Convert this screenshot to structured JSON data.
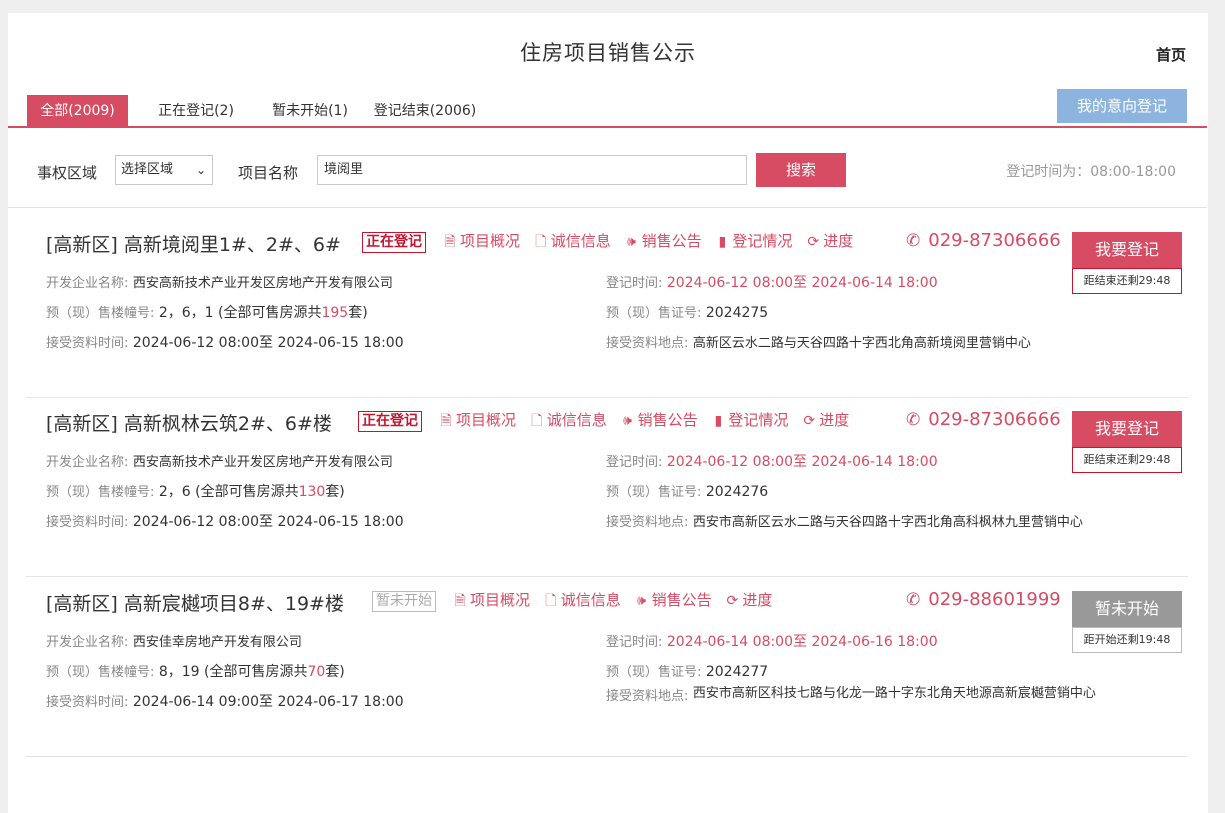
{
  "header": {
    "title": "住房项目销售公示",
    "home": "首页"
  },
  "tabs": [
    {
      "label": "全部(2009)",
      "active": true
    },
    {
      "label": "正在登记(2)",
      "active": false
    },
    {
      "label": "暂未开始(1)",
      "active": false
    },
    {
      "label": "登记结束(2006)",
      "active": false
    }
  ],
  "intent_button": "我的意向登记",
  "filter": {
    "region_label": "事权区域",
    "region_value": "选择区域",
    "name_label": "项目名称",
    "name_value": "境阅里",
    "search_button": "搜索",
    "reg_time_note": "登记时间为：08:00-18:00"
  },
  "field_labels": {
    "developer": "开发企业名称:",
    "reg_time": "登记时间:",
    "buildings": "预（现）售楼幢号:",
    "permit": "预（现）售证号:",
    "doc_time": "接受资料时间:",
    "doc_place": "接受资料地点:"
  },
  "link_labels": {
    "overview": "项目概况",
    "credit": "诚信信息",
    "notice": "销售公告",
    "reg_status": "登记情况",
    "progress": "进度"
  },
  "projects": [
    {
      "title": "[高新区] 高新境阅里1#、2#、6#",
      "status": "正在登记",
      "phone": "029-87306666",
      "button": "我要登记",
      "countdown": "距结束还剩29:48",
      "developer": "西安高新技术产业开发区房地产开发有限公司",
      "reg_time": "2024-06-12 08:00至 2024-06-14 18:00",
      "buildings_prefix": "2，6，1 (全部可售房源共",
      "buildings_count": "195",
      "buildings_suffix": "套)",
      "permit": "2024275",
      "doc_time": "2024-06-12 08:00至 2024-06-15 18:00",
      "doc_place": "高新区云水二路与天谷四路十字西北角高新境阅里营销中心"
    },
    {
      "title": "[高新区] 高新枫林云筑2#、6#楼",
      "status": "正在登记",
      "phone": "029-87306666",
      "button": "我要登记",
      "countdown": "距结束还剩29:48",
      "developer": "西安高新技术产业开发区房地产开发有限公司",
      "reg_time": "2024-06-12 08:00至 2024-06-14 18:00",
      "buildings_prefix": "2，6 (全部可售房源共",
      "buildings_count": "130",
      "buildings_suffix": "套)",
      "permit": "2024276",
      "doc_time": "2024-06-12 08:00至 2024-06-15 18:00",
      "doc_place": "西安市高新区云水二路与天谷四路十字西北角高科枫林九里营销中心"
    },
    {
      "title": "[高新区] 高新宸樾项目8#、19#楼",
      "status": "暂未开始",
      "phone": "029-88601999",
      "button": "暂未开始",
      "countdown": "距开始还剩19:48",
      "developer": "西安佳幸房地产开发有限公司",
      "reg_time": "2024-06-14 08:00至 2024-06-16 18:00",
      "buildings_prefix": "8，19 (全部可售房源共",
      "buildings_count": "70",
      "buildings_suffix": "套)",
      "permit": "2024277",
      "doc_time": "2024-06-14 09:00至 2024-06-17 18:00",
      "doc_place": "西安市高新区科技七路与化龙一路十字东北角天地源高新宸樾营销中心"
    }
  ],
  "colors": {
    "accent": "#d74b63",
    "intent": "#8cb4de",
    "status_red": "#c4152e",
    "gray_button": "#999999"
  },
  "icons": [
    "document-icon",
    "credit-file-icon",
    "speaker-icon",
    "bar-chart-icon",
    "refresh-clock-icon",
    "phone-icon",
    "chevron-down-icon"
  ]
}
